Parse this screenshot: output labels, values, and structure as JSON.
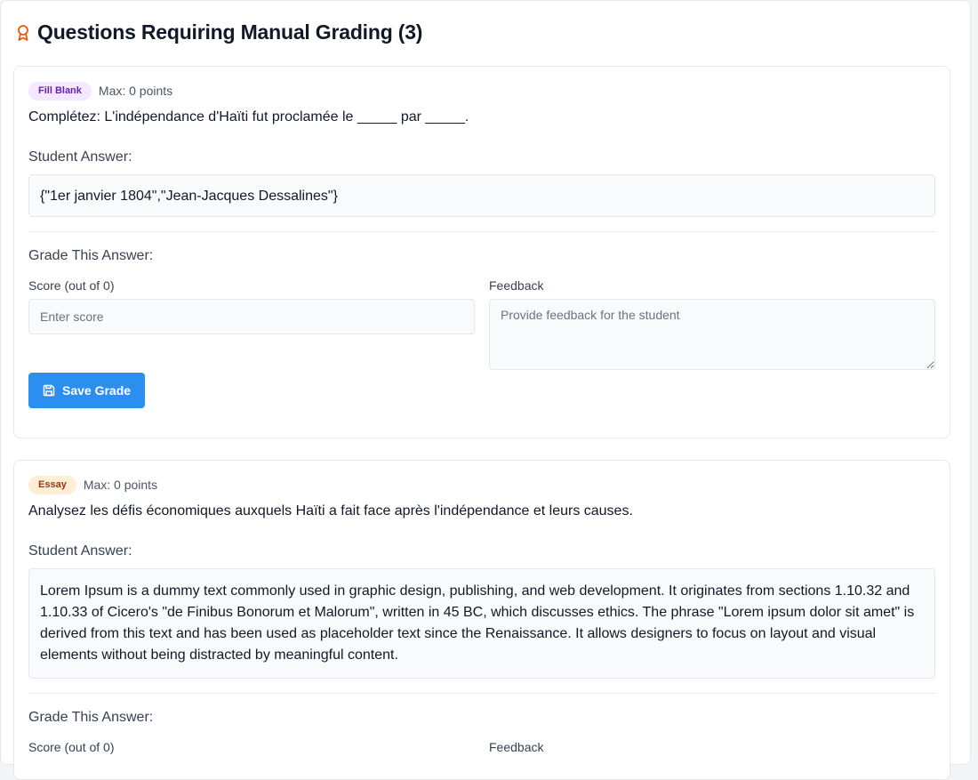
{
  "page": {
    "title": "Questions Requiring Manual Grading (3)",
    "title_icon": "award-icon",
    "accent_color": "#ea580c"
  },
  "questions": [
    {
      "type_badge": "Fill Blank",
      "max_points": "Max: 0 points",
      "question_text": "Complétez: L'indépendance d'Haïti fut proclamée le _____ par _____.",
      "student_answer_label": "Student Answer:",
      "student_answer": "{\"1er janvier 1804\",\"Jean-Jacques Dessalines\"}",
      "grade_label": "Grade This Answer:",
      "score_label": "Score (out of 0)",
      "score_placeholder": "Enter score",
      "feedback_label": "Feedback",
      "feedback_placeholder": "Provide feedback for the student",
      "save_label": "Save Grade"
    },
    {
      "type_badge": "Essay",
      "max_points": "Max: 0 points",
      "question_text": "Analysez les défis économiques auxquels Haïti a fait face après l'indépendance et leurs causes.",
      "student_answer_label": "Student Answer:",
      "student_answer": "Lorem Ipsum is a dummy text commonly used in graphic design, publishing, and web development. It originates from sections 1.10.32 and 1.10.33 of Cicero's \"de Finibus Bonorum et Malorum\", written in 45 BC, which discusses ethics. The phrase \"Lorem ipsum dolor sit amet\" is derived from this text and has been used as placeholder text since the Renaissance. It allows designers to focus on layout and visual elements without being distracted by meaningful content.",
      "grade_label": "Grade This Answer:",
      "score_label": "Score (out of 0)",
      "feedback_label": "Feedback"
    }
  ]
}
